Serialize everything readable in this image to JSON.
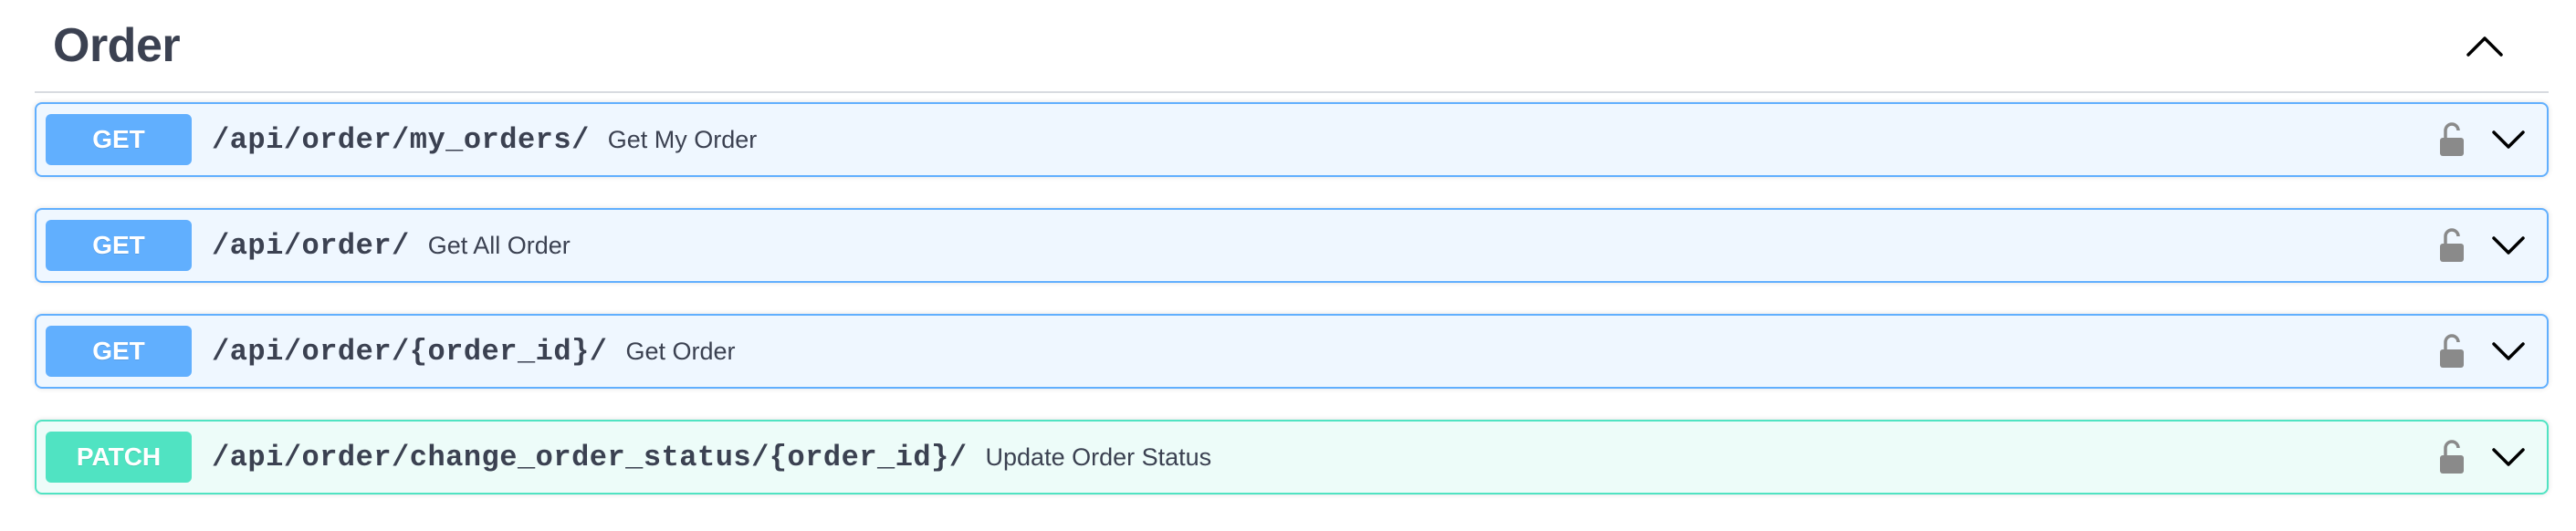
{
  "section": {
    "title": "Order",
    "collapse_icon": "chevron-up-icon"
  },
  "operations": [
    {
      "method": "GET",
      "path": "/api/order/my_orders/",
      "summary": "Get My Order",
      "lock_icon": "unlocked-padlock-icon",
      "expand_icon": "chevron-down-icon"
    },
    {
      "method": "GET",
      "path": "/api/order/",
      "summary": "Get All Order",
      "lock_icon": "unlocked-padlock-icon",
      "expand_icon": "chevron-down-icon"
    },
    {
      "method": "GET",
      "path": "/api/order/{order_id}/",
      "summary": "Get Order",
      "lock_icon": "unlocked-padlock-icon",
      "expand_icon": "chevron-down-icon"
    },
    {
      "method": "PATCH",
      "path": "/api/order/change_order_status/{order_id}/",
      "summary": "Update Order Status",
      "lock_icon": "unlocked-padlock-icon",
      "expand_icon": "chevron-down-icon"
    }
  ],
  "colors": {
    "get": "#61affe",
    "patch": "#50e3c2",
    "text": "#3b4151",
    "icon": "#8a8a8a"
  }
}
